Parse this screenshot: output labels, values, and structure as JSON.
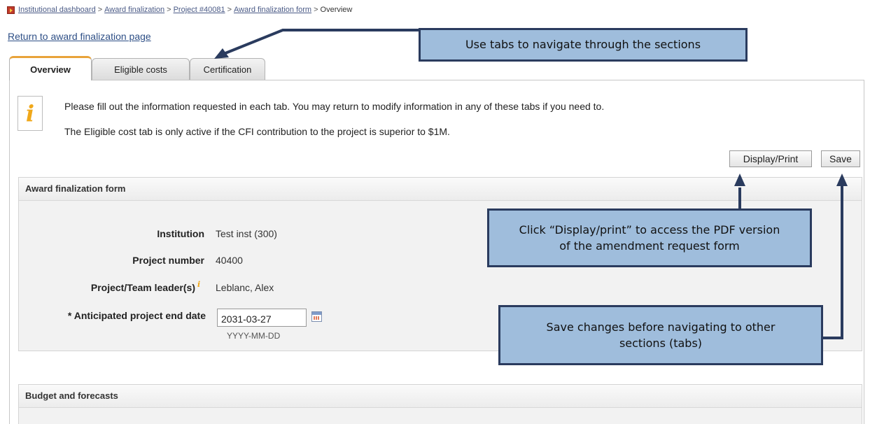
{
  "breadcrumb": {
    "items": [
      "Institutional dashboard",
      "Award finalization",
      "Project #40081",
      "Award finalization form",
      "Overview"
    ],
    "separator": ">"
  },
  "return_link": "Return to award finalization page",
  "tabs": [
    {
      "label": "Overview",
      "active": true
    },
    {
      "label": "Eligible costs",
      "active": false
    },
    {
      "label": "Certification",
      "active": false
    }
  ],
  "info": {
    "icon": "info-icon",
    "line1": "Please fill out the information requested in each tab. You may return to modify information in any of these tabs if you need to.",
    "line2": "The Eligible cost tab is only active if the CFI contribution to the project is superior to $1M."
  },
  "buttons": {
    "display_print": "Display/Print",
    "save": "Save"
  },
  "award_form": {
    "title": "Award finalization form",
    "institution_label": "Institution",
    "institution_value": "Test inst (300)",
    "project_number_label": "Project number",
    "project_number_value": "40400",
    "leader_label": "Project/Team leader(s)",
    "leader_value": "Leblanc, Alex",
    "end_date_label": "* Anticipated project end date",
    "end_date_value": "2031-03-27",
    "end_date_hint": "YYYY-MM-DD"
  },
  "budget_section": {
    "title": "Budget and forecasts"
  },
  "callouts": {
    "tabs": "Use tabs to navigate through the sections",
    "display": "Click “Display/print” to access the PDF version of the amendment request form",
    "save": "Save changes before navigating to other sections (tabs)"
  },
  "colors": {
    "callout_bg": "#9fbddc",
    "callout_border": "#2a3b5e",
    "tab_accent": "#e8a33a",
    "link": "#2e4f86"
  }
}
